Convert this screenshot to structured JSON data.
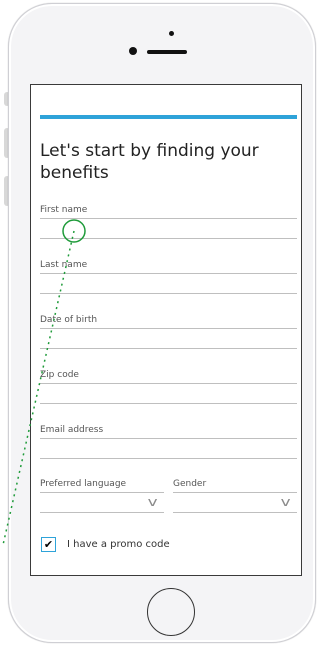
{
  "colors": {
    "accent": "#2ea3d9",
    "touch_indicator": "#1f9b3a"
  },
  "form": {
    "title": "Let's start by finding your benefits",
    "fields": {
      "first_name": "First name",
      "last_name": "Last name",
      "date_of_birth": "Date of birth",
      "zip_code": "Zip code",
      "email_address": "Email address"
    },
    "preferred_language": {
      "label": "Preferred language",
      "value": ""
    },
    "gender": {
      "label": "Gender",
      "value": ""
    },
    "promo": {
      "label": "I have a promo code",
      "checked": true
    }
  }
}
